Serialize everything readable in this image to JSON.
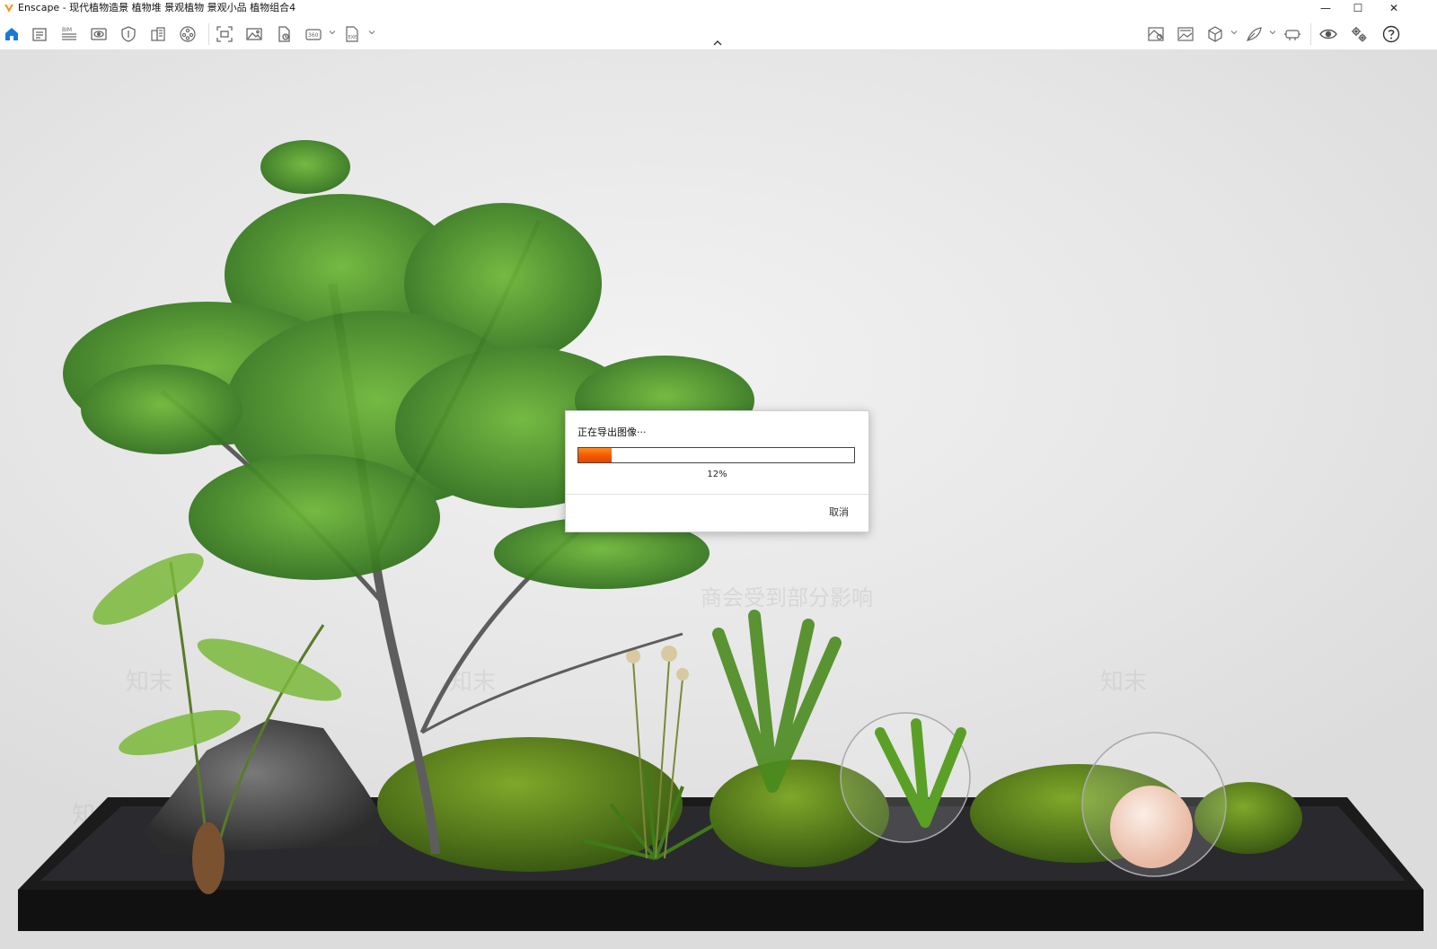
{
  "window": {
    "title": "Enscape - 现代植物造景 植物堆 景观植物 景观小品 植物组合4",
    "minimize_glyph": "—",
    "maximize_glyph": "☐",
    "close_glyph": "✕"
  },
  "toolbar": {
    "left_icons": [
      "home-icon",
      "notes-icon",
      "bim-icon",
      "view-icon",
      "safe-frame-icon",
      "buildings-icon",
      "video-editor-icon",
      "screenshot-icon",
      "render-image-icon",
      "batch-render-icon",
      "panorama-360-icon",
      "export-file-icon"
    ],
    "right_icons": [
      "map-icon",
      "sky-image-icon",
      "asset-library-icon",
      "material-editor-icon",
      "vr-headset-icon",
      "visibility-icon",
      "settings-icon",
      "help-icon"
    ],
    "bim_label": "BIM",
    "panorama_label": "360",
    "export_label": "EXE"
  },
  "dialog": {
    "title": "正在导出图像···",
    "progress": 0.12,
    "progress_text": "12%",
    "cancel_label": "取消"
  },
  "watermark": {
    "text": "知末",
    "banner": "商会受到部分影响"
  },
  "colors": {
    "accent": "#1a7ad9",
    "progress": "#f05a00",
    "logo": "#f59a23"
  }
}
